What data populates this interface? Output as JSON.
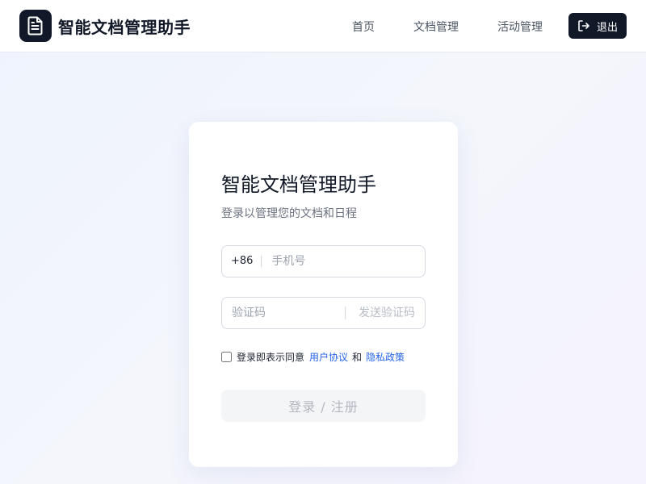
{
  "header": {
    "app_title": "智能文档管理助手",
    "logo_icon": "document-icon",
    "nav": [
      {
        "label": "首页"
      },
      {
        "label": "文档管理"
      },
      {
        "label": "活动管理"
      }
    ],
    "logout_label": "退出",
    "logout_icon": "logout-icon"
  },
  "login": {
    "title": "智能文档管理助手",
    "subtitle": "登录以管理您的文档和日程",
    "phone_prefix": "+86",
    "phone_placeholder": "手机号",
    "code_placeholder": "验证码",
    "send_code_label": "发送验证码",
    "agree_text": "登录即表示同意",
    "user_agreement": "用户协议",
    "and_text": "和",
    "privacy_policy": "隐私政策",
    "submit_label": "登录 / 注册"
  },
  "colors": {
    "brand_dark": "#111827",
    "link": "#2563eb"
  }
}
